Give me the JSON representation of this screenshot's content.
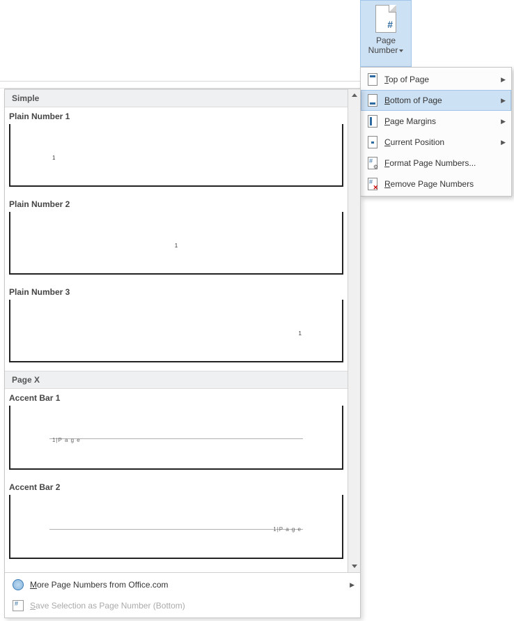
{
  "ribbon": {
    "page_number_line1": "Page",
    "page_number_line2": "Number"
  },
  "dropdown": {
    "items": [
      {
        "label": "Top of Page",
        "accel": "T",
        "arrow": true,
        "icon": "top"
      },
      {
        "label": "Bottom of Page",
        "accel": "B",
        "arrow": true,
        "icon": "bottom",
        "hover": true
      },
      {
        "label": "Page Margins",
        "accel": "P",
        "arrow": true,
        "icon": "margins"
      },
      {
        "label": "Current Position",
        "accel": "C",
        "arrow": true,
        "icon": "current"
      },
      {
        "label": "Format Page Numbers...",
        "accel": "F",
        "arrow": false,
        "icon": "format"
      },
      {
        "label": "Remove Page Numbers",
        "accel": "R",
        "arrow": false,
        "icon": "remove"
      }
    ]
  },
  "gallery": {
    "groups": [
      {
        "header": "Simple",
        "items": [
          {
            "title": "Plain Number 1",
            "kind": "pn1",
            "marker": "1"
          },
          {
            "title": "Plain Number 2",
            "kind": "pn2",
            "marker": "1"
          },
          {
            "title": "Plain Number 3",
            "kind": "pn3",
            "marker": "1"
          }
        ]
      },
      {
        "header": "Page X",
        "items": [
          {
            "title": "Accent Bar 1",
            "kind": "acc1",
            "marker": "1|P a g e"
          },
          {
            "title": "Accent Bar 2",
            "kind": "acc2",
            "marker": "1|P a g e"
          }
        ]
      }
    ],
    "footer": {
      "more": "More Page Numbers from Office.com",
      "more_accel": "M",
      "save": "Save Selection as Page Number (Bottom)",
      "save_accel": "S"
    }
  }
}
